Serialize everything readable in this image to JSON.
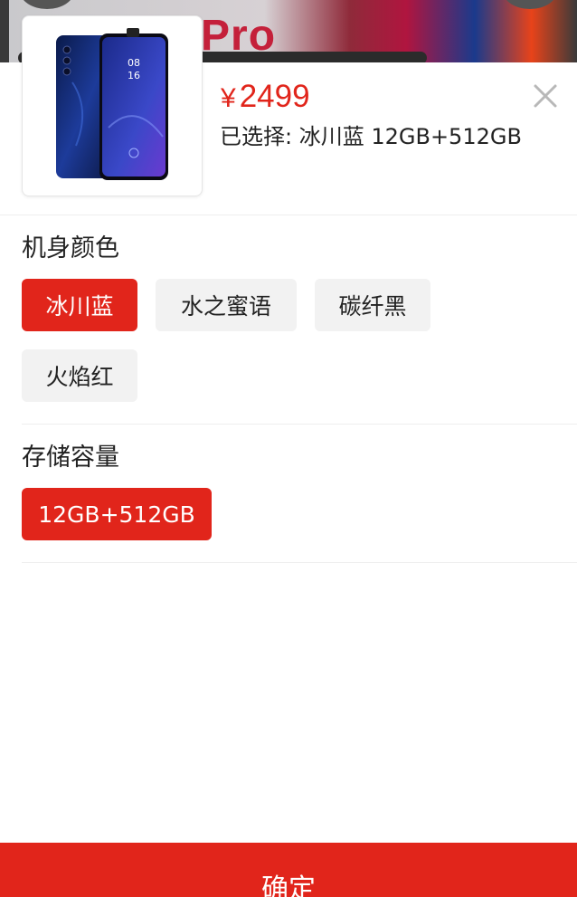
{
  "backdrop": {
    "banner_text": "Pro"
  },
  "product": {
    "image_icon": "phone-product-image",
    "phone_time": "08\n16"
  },
  "price": {
    "currency": "¥",
    "amount": "2499"
  },
  "selection": {
    "text": "已选择: 冰川蓝 12GB+512GB"
  },
  "close_icon": "close-icon",
  "color_section": {
    "title": "机身颜色",
    "options": [
      "冰川蓝",
      "水之蜜语",
      "碳纤黑",
      "火焰红"
    ],
    "selected_index": 0
  },
  "storage_section": {
    "title": "存储容量",
    "options": [
      "12GB+512GB"
    ],
    "selected_index": 0
  },
  "confirm_button": {
    "label": "确定"
  },
  "colors": {
    "accent": "#e1251b",
    "option_bg": "#f2f2f2",
    "text": "#222222"
  }
}
